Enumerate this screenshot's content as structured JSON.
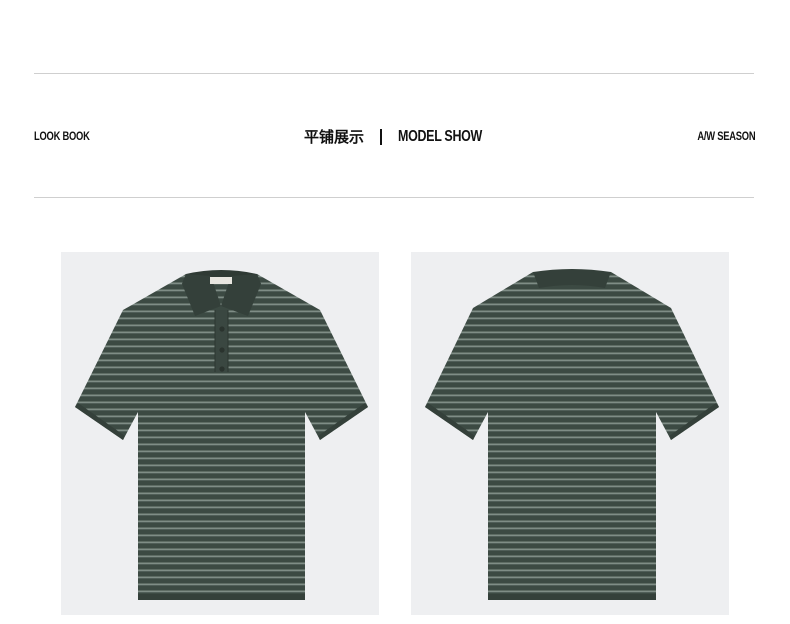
{
  "header": {
    "left_label": "LOOK BOOK",
    "title_cn": "平铺展示",
    "title_en": "MODEL SHOW",
    "right_label": "A/W SEASON"
  },
  "products": [
    {
      "view": "front",
      "icon": "polo-shirt-front"
    },
    {
      "view": "back",
      "icon": "polo-shirt-back"
    }
  ],
  "colors": {
    "shirt_base": "#3c4a43",
    "stripe_light": "#7f8d86",
    "collar": "#34403a",
    "panel_bg": "#eeeff1"
  }
}
